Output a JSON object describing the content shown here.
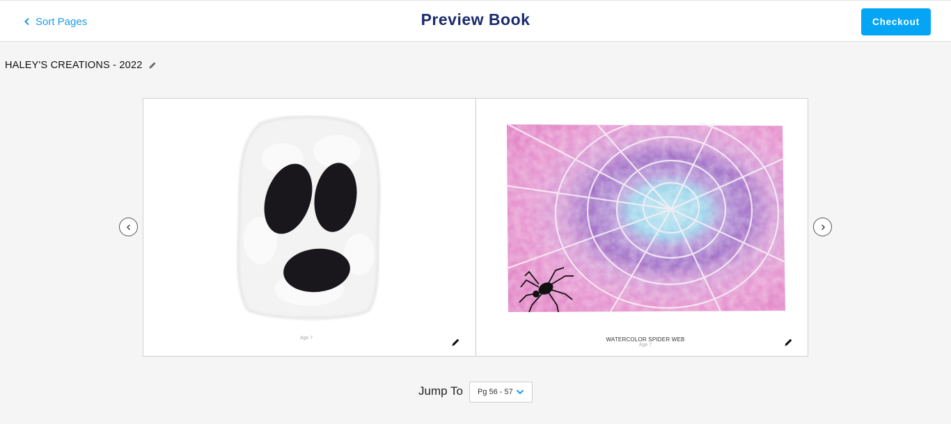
{
  "header": {
    "back_label": "Sort Pages",
    "title": "Preview Book",
    "checkout_label": "Checkout"
  },
  "book": {
    "title": "HALEY'S CREATIONS - 2022"
  },
  "spread": {
    "left_page": {
      "artwork": "ghost-artwork",
      "age_caption": "Age 7"
    },
    "right_page": {
      "artwork": "watercolor-spider-web-artwork",
      "title_caption": "WATERCOLOR SPIDER WEB",
      "age_caption": "Age 7"
    }
  },
  "jump": {
    "label": "Jump To",
    "selected": "Pg 56 - 57"
  },
  "colors": {
    "accent": "#04a5f5",
    "link": "#1a9be6",
    "title": "#1b2a6b",
    "background": "#f5f5f5"
  },
  "icons": {
    "back": "chevron-left-icon",
    "edit_title": "pencil-icon",
    "edit_page": "pencil-icon",
    "prev": "chevron-left-icon",
    "next": "chevron-right-icon",
    "select": "chevron-down-icon"
  }
}
